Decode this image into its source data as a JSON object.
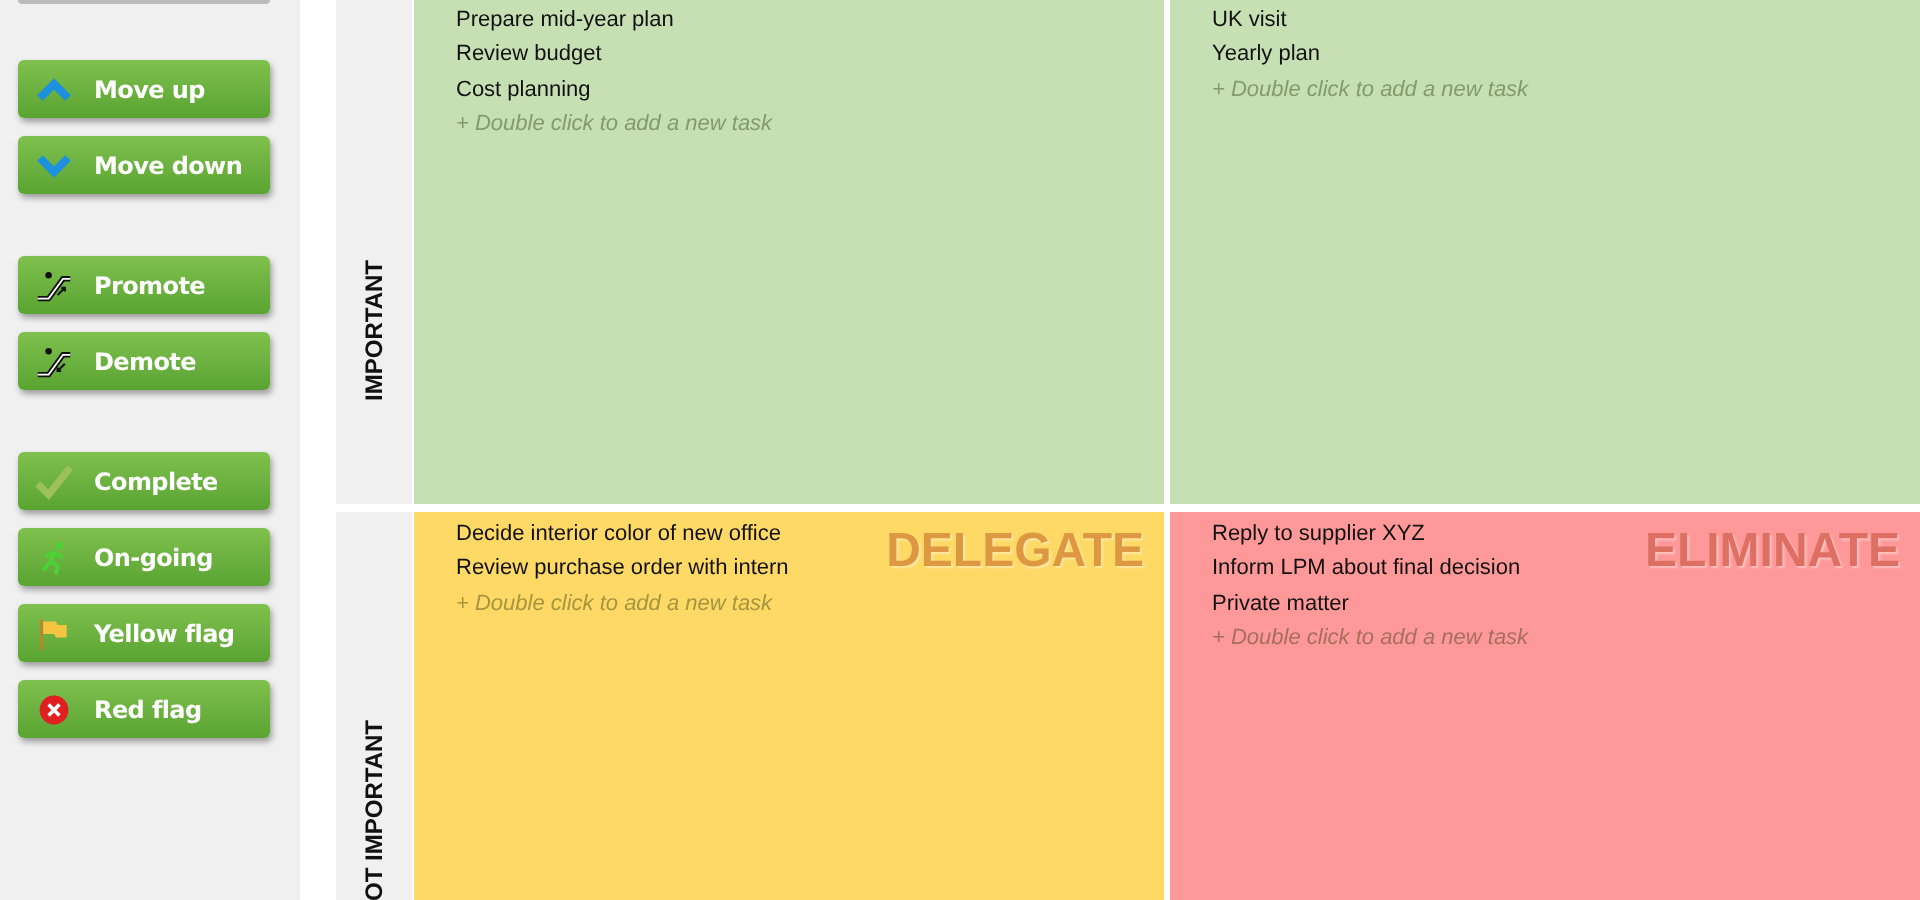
{
  "sidebar": {
    "button_groups": [
      [
        {
          "label": "Move up",
          "kind": "up"
        },
        {
          "label": "Move down",
          "kind": "down"
        }
      ],
      [
        {
          "label": "Promote",
          "kind": "promote"
        },
        {
          "label": "Demote",
          "kind": "demote"
        }
      ],
      [
        {
          "label": "Complete",
          "kind": "complete"
        },
        {
          "label": "On-going",
          "kind": "ongoing"
        },
        {
          "label": "Yellow flag",
          "kind": "flag"
        },
        {
          "label": "Red flag",
          "kind": "error"
        }
      ]
    ]
  },
  "matrix": {
    "rows": [
      {
        "label": "IMPORTANT",
        "quadrants": [
          {
            "color": "#c6e0b4",
            "tasks": [
              "Prepare mid-year plan",
              "Review budget",
              "Cost planning"
            ],
            "hint": "+ Double click to add a new task"
          },
          {
            "color": "#c6e0b4",
            "tasks": [
              "UK visit",
              "Yearly plan"
            ],
            "hint": "+ Double click to add a new task"
          }
        ]
      },
      {
        "label": "OT IMPORTANT",
        "quadrants": [
          {
            "color": "#ffd966",
            "title": "DELEGATE",
            "tasks": [
              "Decide interior color of new office",
              "Review purchase order with intern"
            ],
            "hint": "+ Double click to add a new task"
          },
          {
            "color": "#ff9999",
            "title": "ELIMINATE",
            "tasks": [
              "Reply to supplier XYZ",
              "Inform LPM about final decision",
              "Private matter"
            ],
            "hint": "+ Double click to add a new task"
          }
        ]
      }
    ]
  }
}
